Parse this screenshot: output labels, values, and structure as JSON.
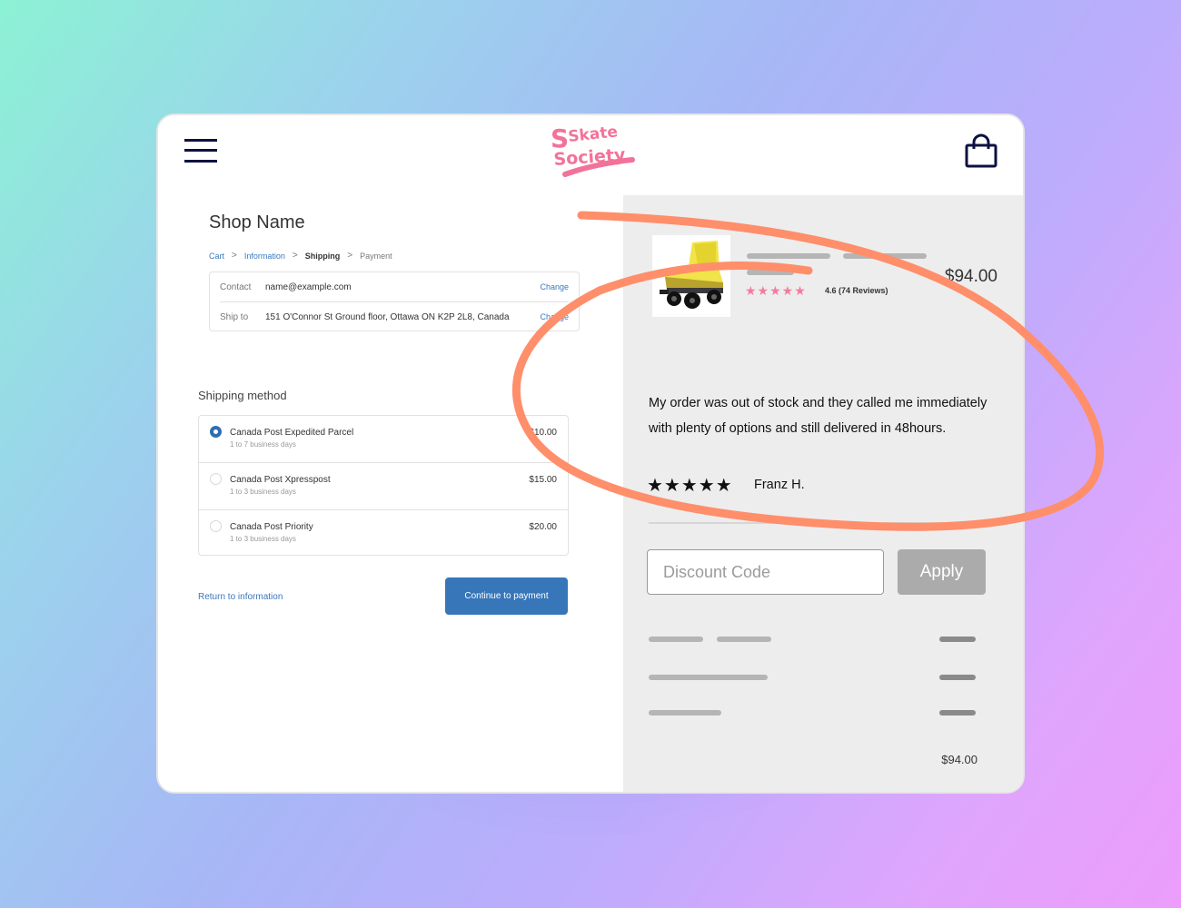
{
  "theme": {
    "accent": "#3676b9",
    "link": "#3a79bd",
    "nav_icon_color": "#0c1141",
    "brand_pink": "#f47b9e",
    "annotation": "#ff8e6b",
    "panel_bg": "#ededed"
  },
  "header": {
    "menu_icon": "hamburger-menu-icon",
    "logo_line1": "Skate",
    "logo_line2": "Society",
    "cart_icon": "shopping-bag-icon"
  },
  "checkout": {
    "shop_name": "Shop Name",
    "breadcrumb": [
      {
        "label": "Cart",
        "state": "link"
      },
      {
        "label": "Information",
        "state": "link"
      },
      {
        "label": "Shipping",
        "state": "current"
      },
      {
        "label": "Payment",
        "state": "upcoming"
      }
    ],
    "breadcrumb_separator": ">",
    "contact": {
      "label": "Contact",
      "value": "name@example.com",
      "action": "Change"
    },
    "ship_to": {
      "label": "Ship to",
      "value": "151 O'Connor St Ground floor, Ottawa ON K2P 2L8, Canada",
      "action": "Change"
    },
    "shipping_method_title": "Shipping method",
    "shipping_options": [
      {
        "name": "Canada Post Expedited Parcel",
        "eta": "1 to 7 business days",
        "price": "$10.00",
        "selected": true
      },
      {
        "name": "Canada Post Xpresspost",
        "eta": "1 to 3 business days",
        "price": "$15.00",
        "selected": false
      },
      {
        "name": "Canada Post Priority",
        "eta": "1 to 3 business days",
        "price": "$20.00",
        "selected": false
      }
    ],
    "return_link": "Return to information",
    "continue_button": "Continue to payment"
  },
  "summary": {
    "product": {
      "image": "yellow-roller-skate",
      "price": "$94.00",
      "stars": "★★★★★",
      "rating_text": "4.6 (74 Reviews)"
    },
    "review": {
      "text": "My order was out of stock and they called me immediately with plenty of options and still delivered in 48hours.",
      "stars": "★★★★★",
      "author": "Franz H."
    },
    "discount": {
      "placeholder": "Discount Code",
      "value": "",
      "apply_label": "Apply"
    },
    "total": "$94.00"
  }
}
